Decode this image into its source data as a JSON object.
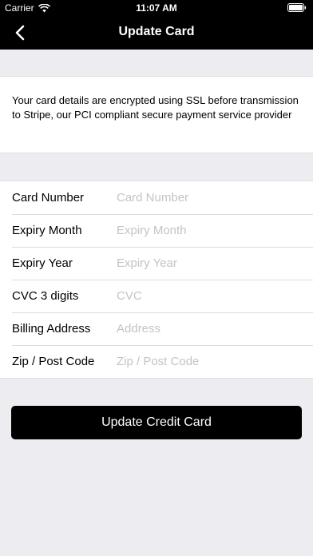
{
  "status_bar": {
    "carrier": "Carrier",
    "time": "11:07 AM",
    "wifi_icon": "wifi-icon",
    "battery_icon": "battery-icon"
  },
  "nav": {
    "title": "Update Card",
    "back_icon": "chevron-left-icon"
  },
  "notice": {
    "text": "Your card details are encrypted using SSL before transmission to Stripe, our PCI compliant secure payment service provider"
  },
  "form": {
    "fields": [
      {
        "label": "Card Number",
        "placeholder": "Card Number",
        "value": ""
      },
      {
        "label": "Expiry Month",
        "placeholder": "Expiry Month",
        "value": ""
      },
      {
        "label": "Expiry Year",
        "placeholder": "Expiry Year",
        "value": ""
      },
      {
        "label": "CVC 3 digits",
        "placeholder": "CVC",
        "value": ""
      },
      {
        "label": "Billing Address",
        "placeholder": "Address",
        "value": ""
      },
      {
        "label": "Zip / Post Code",
        "placeholder": "Zip / Post Code",
        "value": ""
      }
    ]
  },
  "submit": {
    "label": "Update Credit Card"
  },
  "colors": {
    "bar_background": "#000000",
    "page_background": "#ececf1",
    "placeholder": "#c3c3c9",
    "button_background": "#000000"
  }
}
